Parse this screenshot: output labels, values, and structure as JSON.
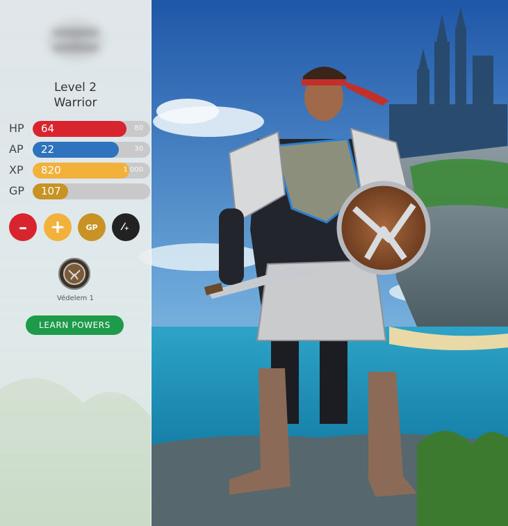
{
  "character": {
    "level_text": "Level 2",
    "class_text": "Warrior"
  },
  "stats": [
    {
      "key": "hp",
      "label": "HP",
      "value": "64",
      "max": "80",
      "fraction": 0.8,
      "color": "#d8242f"
    },
    {
      "key": "ap",
      "label": "AP",
      "value": "22",
      "max": "30",
      "fraction": 0.733,
      "color": "#2f73be"
    },
    {
      "key": "xp",
      "label": "XP",
      "value": "820",
      "max": "1 000",
      "fraction": 0.82,
      "color": "#f2b13a"
    },
    {
      "key": "gp",
      "label": "GP",
      "value": "107",
      "max": "",
      "fraction": 0.3,
      "color": "#c89225"
    }
  ],
  "actions": [
    {
      "key": "minus",
      "icon": "minus-icon",
      "glyph": "–",
      "color": "#d8242f"
    },
    {
      "key": "plus",
      "icon": "plus-icon",
      "glyph": "+",
      "color": "#f2b13a"
    },
    {
      "key": "gp",
      "icon": "gp-icon",
      "glyph": "GP",
      "color": "#c89225"
    },
    {
      "key": "ratio",
      "icon": "percent-icon",
      "glyph": "⁄₊",
      "color": "#222222"
    }
  ],
  "power": {
    "icon": "shield-power-icon",
    "label": "Védelem 1"
  },
  "learn_button": "LEARN POWERS"
}
